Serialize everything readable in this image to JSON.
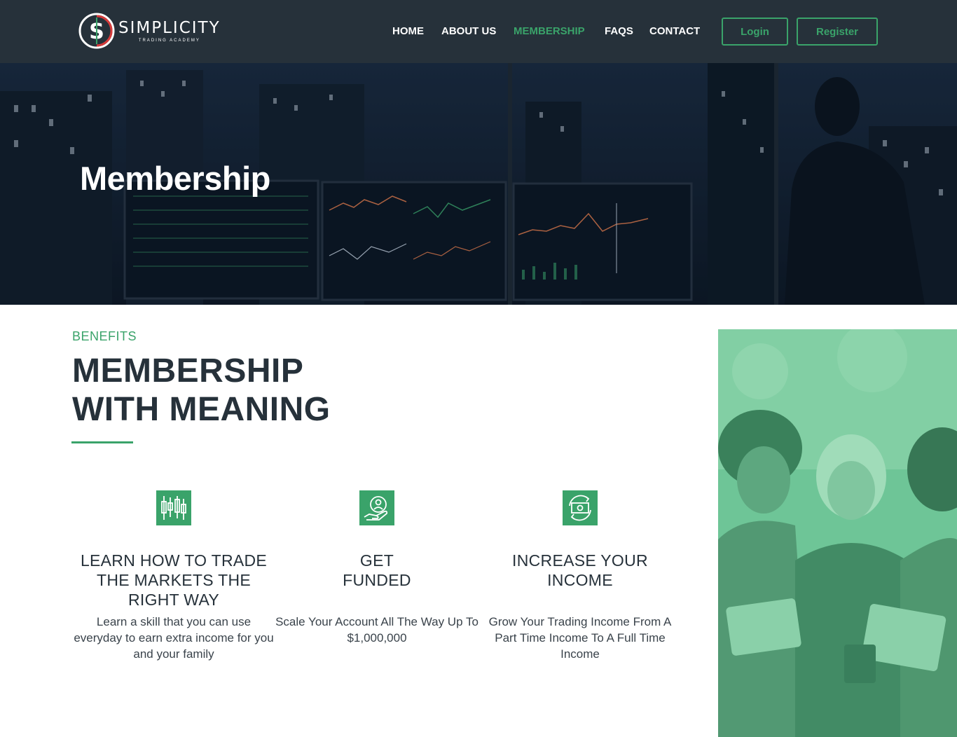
{
  "brand": {
    "name": "SIMPLICITY",
    "tagline": "TRADING ACADEMY",
    "logo_letter": "S"
  },
  "nav": {
    "items": [
      {
        "label": "HOME",
        "active": false
      },
      {
        "label": "ABOUT US",
        "active": false
      },
      {
        "label": "MEMBERSHIP",
        "active": true
      },
      {
        "label": "FAQS",
        "active": false
      },
      {
        "label": "CONTACT",
        "active": false
      }
    ],
    "login_label": "Login",
    "register_label": "Register"
  },
  "hero": {
    "title": "Membership"
  },
  "benefits": {
    "eyebrow": "BENEFITS",
    "title_line1": "MEMBERSHIP",
    "title_line2": "WITH MEANING",
    "items": [
      {
        "icon": "candlestick-chart-icon",
        "heading": "LEARN HOW TO TRADE THE MARKETS THE RIGHT WAY",
        "text": "Learn a skill that you can use everyday to earn extra income for you and your family"
      },
      {
        "icon": "funded-person-hand-icon",
        "heading": "GET FUNDED",
        "text": "Scale Your Account All The Way Up To $1,000,000"
      },
      {
        "icon": "money-cycle-icon",
        "heading": "INCREASE YOUR INCOME",
        "text": "Grow Your Trading Income From A Part Time Income To A Full Time Income"
      }
    ]
  },
  "colors": {
    "accent": "#3aa36a",
    "header_bg": "#26313a",
    "heading_text": "#26313a"
  }
}
